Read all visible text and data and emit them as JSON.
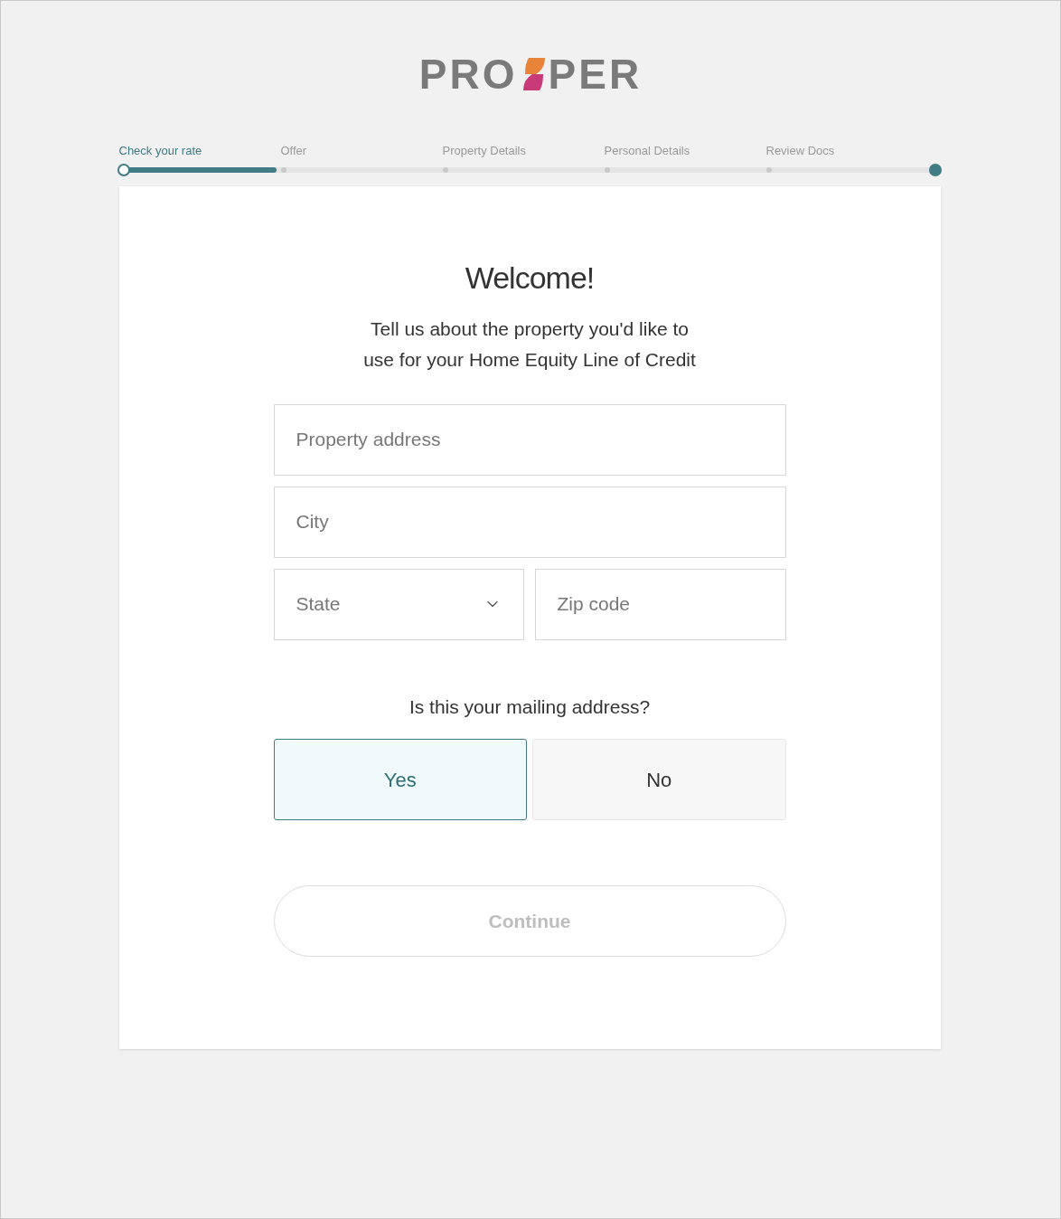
{
  "logo": {
    "left": "PRO",
    "right": "PER"
  },
  "progress": {
    "level": 0.19,
    "steps": [
      {
        "label": "Check your rate",
        "selected": true
      },
      {
        "label": "Offer",
        "selected": false
      },
      {
        "label": "Property Details",
        "selected": false
      },
      {
        "label": "Personal Details",
        "selected": false
      },
      {
        "label": "Review Docs",
        "selected": false
      }
    ]
  },
  "heading": "Welcome!",
  "intro": [
    "Tell us about the property you'd like to",
    "use for your Home Equity Line of Credit"
  ],
  "fields": {
    "address": {
      "placeholder": "Property address"
    },
    "city": {
      "placeholder": "City"
    },
    "state": {
      "placeholder": "State"
    },
    "zip": {
      "placeholder": "Zip code"
    }
  },
  "question": "Is this your mailing address?",
  "options": [
    {
      "label": "Yes",
      "selected": true
    },
    {
      "label": "No",
      "selected": false
    }
  ],
  "continue": {
    "label": "Continue",
    "disabled": true
  }
}
